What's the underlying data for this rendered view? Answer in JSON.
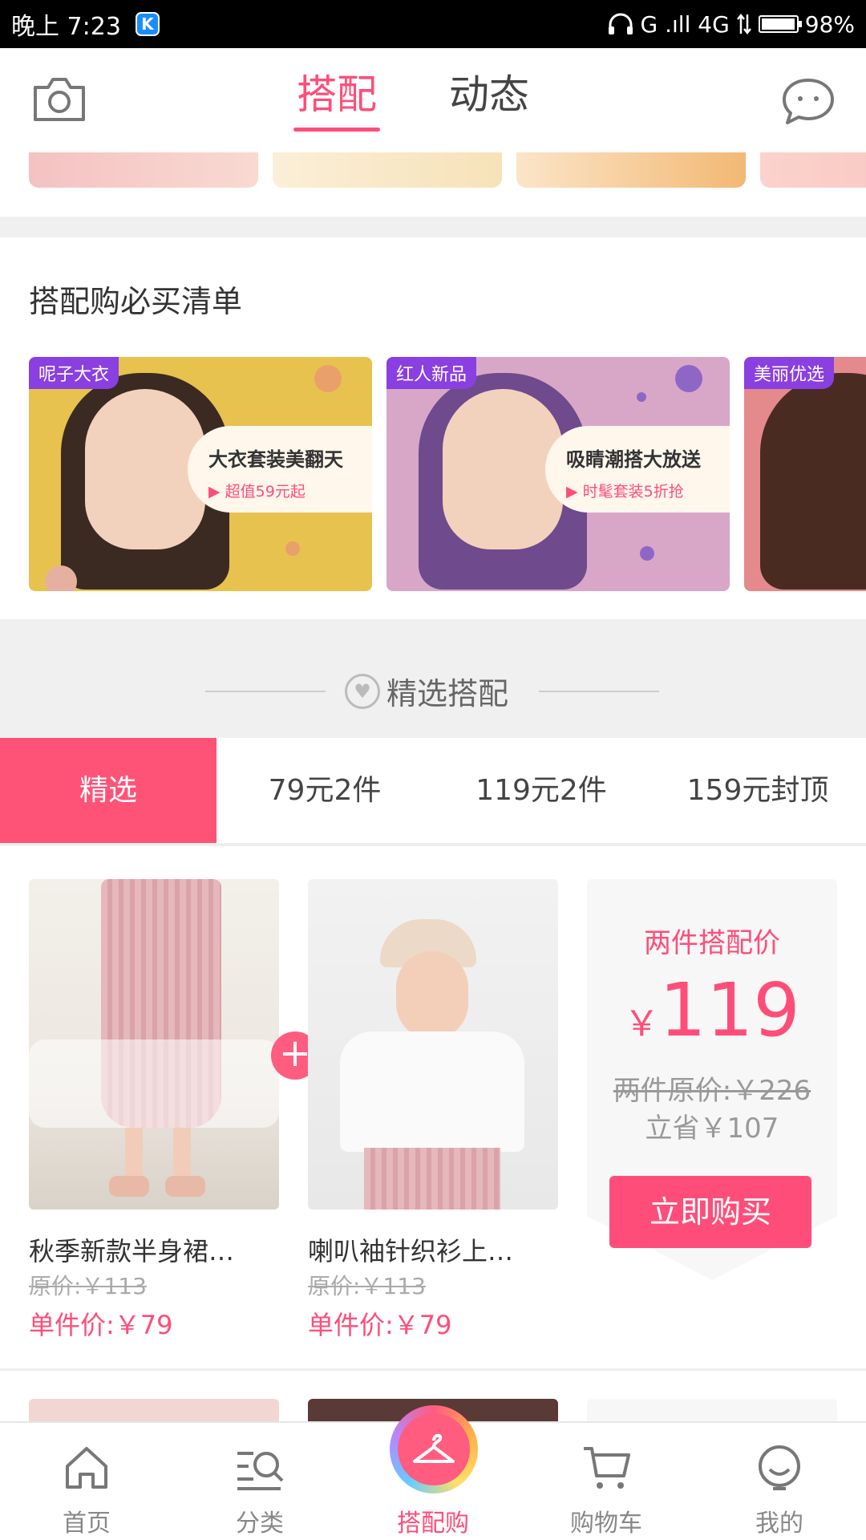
{
  "status_bar": {
    "time": "晚上 7:23",
    "app_badge": "K",
    "network": "G .ıll 4G",
    "battery_level": 0.98,
    "battery_text": "98%"
  },
  "top_nav": {
    "tabs": [
      {
        "label": "搭配",
        "active": true
      },
      {
        "label": "动态",
        "active": false
      }
    ],
    "left_icon": "camera-icon",
    "right_icon": "chat-bubble-icon"
  },
  "must_buy": {
    "title": "搭配购必买清单",
    "cards": [
      {
        "tag": "呢子大衣",
        "headline": "大衣套装美翻天",
        "sub": "超值59元起"
      },
      {
        "tag": "红人新品",
        "headline": "吸睛潮搭大放送",
        "sub": "时髦套装5折抢"
      },
      {
        "tag": "美丽优选",
        "headline": "",
        "sub": ""
      }
    ]
  },
  "featured": {
    "title": "精选搭配"
  },
  "filters": [
    {
      "label": "精选",
      "active": true
    },
    {
      "label": "79元2件",
      "active": false
    },
    {
      "label": "119元2件",
      "active": false
    },
    {
      "label": "159元封顶",
      "active": false
    }
  ],
  "products": [
    {
      "name": "秋季新款半身裙…",
      "orig_price": "原价:￥113",
      "unit_price": "单件价:￥79"
    },
    {
      "name": "喇叭袖针织衫上…",
      "orig_price": "原价:￥113",
      "unit_price": "单件价:￥79"
    }
  ],
  "combo": {
    "title": "两件搭配价",
    "currency": "￥",
    "price": "119",
    "orig": "两件原价:￥226",
    "save": "立省￥107",
    "buy_label": "立即购买"
  },
  "bottom_nav": [
    {
      "label": "首页",
      "icon": "home-icon",
      "active": false
    },
    {
      "label": "分类",
      "icon": "category-search-icon",
      "active": false
    },
    {
      "label": "搭配购",
      "icon": "hanger-icon",
      "active": true
    },
    {
      "label": "购物车",
      "icon": "cart-icon",
      "active": false
    },
    {
      "label": "我的",
      "icon": "profile-smile-icon",
      "active": false
    }
  ],
  "colors": {
    "accent": "#ff4d79",
    "filter_active": "#ff5277",
    "tag_purple": "#8a3fe0"
  }
}
